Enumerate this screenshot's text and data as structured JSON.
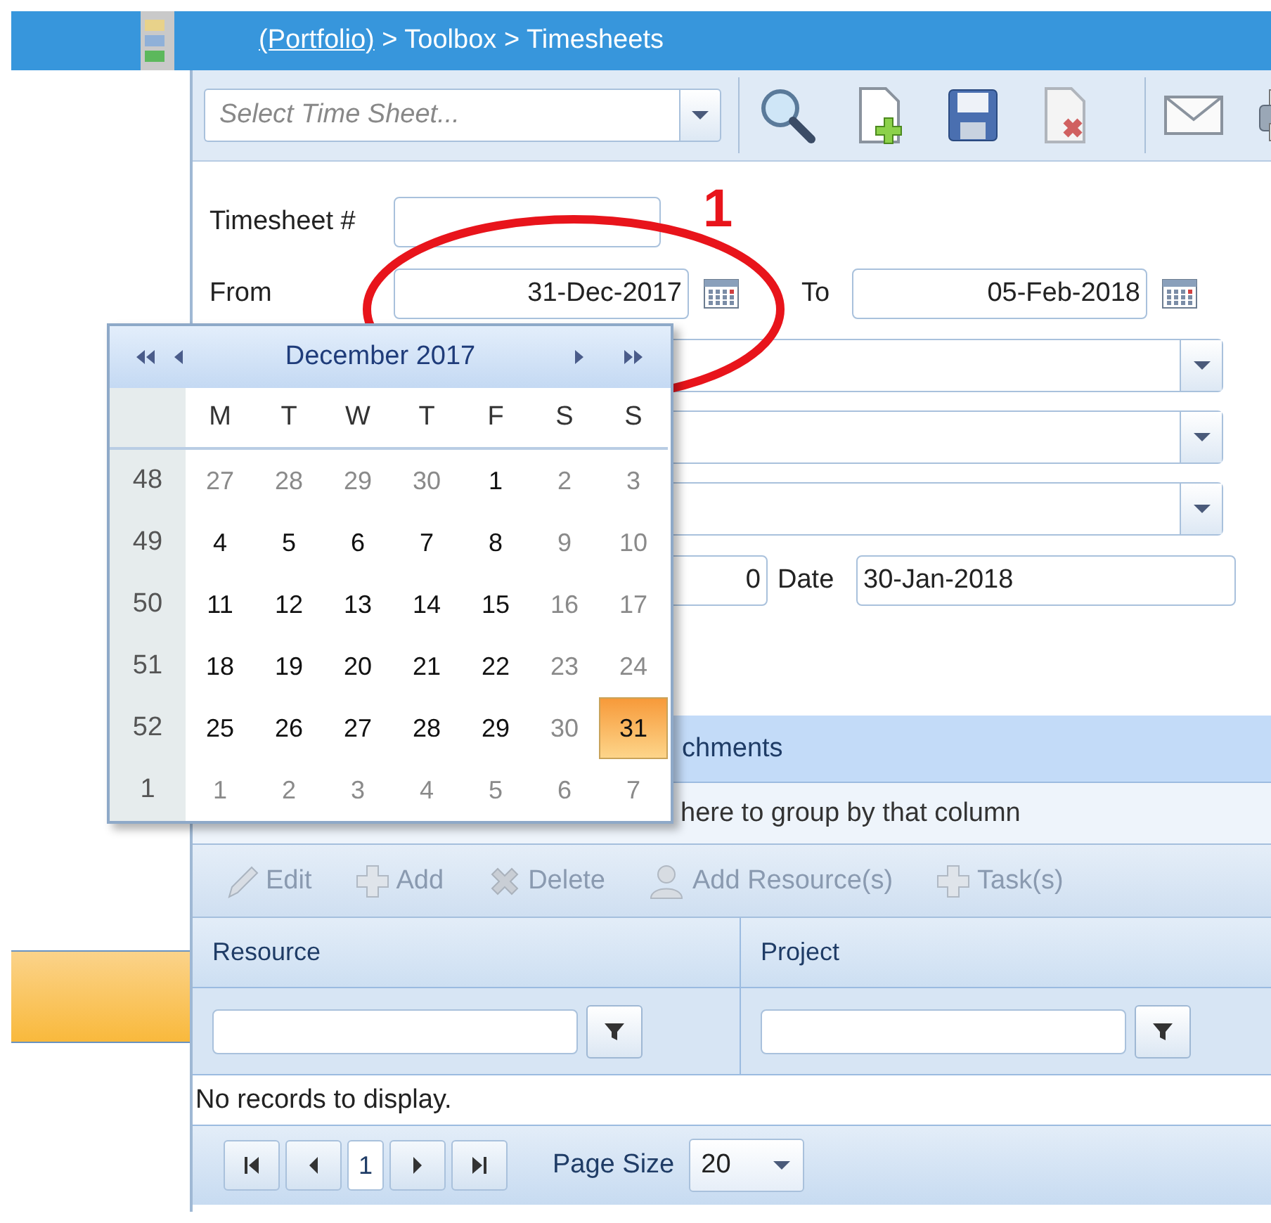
{
  "breadcrumb": {
    "link": "(Portfolio)",
    "path": "> Toolbox > Timesheets"
  },
  "toolbar": {
    "select_placeholder": "Select Time Sheet..."
  },
  "form": {
    "timesheet_label": "Timesheet #",
    "from_label": "From",
    "from_value": "31-Dec-2017",
    "to_label": "To",
    "to_value": "05-Feb-2018",
    "number_value": "0",
    "date_label": "Date",
    "date_value": "30-Jan-2018"
  },
  "annotation": {
    "label": "1"
  },
  "calendar": {
    "title": "December 2017",
    "weekdays": [
      "M",
      "T",
      "W",
      "T",
      "F",
      "S",
      "S"
    ],
    "weeks": [
      {
        "number": "48",
        "days": [
          {
            "day": "27",
            "muted": true,
            "selected": false
          },
          {
            "day": "28",
            "muted": true,
            "selected": false
          },
          {
            "day": "29",
            "muted": true,
            "selected": false
          },
          {
            "day": "30",
            "muted": true,
            "selected": false
          },
          {
            "day": "1",
            "muted": false,
            "selected": false
          },
          {
            "day": "2",
            "muted": true,
            "selected": false
          },
          {
            "day": "3",
            "muted": true,
            "selected": false
          }
        ]
      },
      {
        "number": "49",
        "days": [
          {
            "day": "4",
            "muted": false,
            "selected": false
          },
          {
            "day": "5",
            "muted": false,
            "selected": false
          },
          {
            "day": "6",
            "muted": false,
            "selected": false
          },
          {
            "day": "7",
            "muted": false,
            "selected": false
          },
          {
            "day": "8",
            "muted": false,
            "selected": false
          },
          {
            "day": "9",
            "muted": true,
            "selected": false
          },
          {
            "day": "10",
            "muted": true,
            "selected": false
          }
        ]
      },
      {
        "number": "50",
        "days": [
          {
            "day": "11",
            "muted": false,
            "selected": false
          },
          {
            "day": "12",
            "muted": false,
            "selected": false
          },
          {
            "day": "13",
            "muted": false,
            "selected": false
          },
          {
            "day": "14",
            "muted": false,
            "selected": false
          },
          {
            "day": "15",
            "muted": false,
            "selected": false
          },
          {
            "day": "16",
            "muted": true,
            "selected": false
          },
          {
            "day": "17",
            "muted": true,
            "selected": false
          }
        ]
      },
      {
        "number": "51",
        "days": [
          {
            "day": "18",
            "muted": false,
            "selected": false
          },
          {
            "day": "19",
            "muted": false,
            "selected": false
          },
          {
            "day": "20",
            "muted": false,
            "selected": false
          },
          {
            "day": "21",
            "muted": false,
            "selected": false
          },
          {
            "day": "22",
            "muted": false,
            "selected": false
          },
          {
            "day": "23",
            "muted": true,
            "selected": false
          },
          {
            "day": "24",
            "muted": true,
            "selected": false
          }
        ]
      },
      {
        "number": "52",
        "days": [
          {
            "day": "25",
            "muted": false,
            "selected": false
          },
          {
            "day": "26",
            "muted": false,
            "selected": false
          },
          {
            "day": "27",
            "muted": false,
            "selected": false
          },
          {
            "day": "28",
            "muted": false,
            "selected": false
          },
          {
            "day": "29",
            "muted": false,
            "selected": false
          },
          {
            "day": "30",
            "muted": true,
            "selected": false
          },
          {
            "day": "31",
            "muted": false,
            "selected": true
          }
        ]
      },
      {
        "number": "1",
        "days": [
          {
            "day": "1",
            "muted": true,
            "selected": false
          },
          {
            "day": "2",
            "muted": true,
            "selected": false
          },
          {
            "day": "3",
            "muted": true,
            "selected": false
          },
          {
            "day": "4",
            "muted": true,
            "selected": false
          },
          {
            "day": "5",
            "muted": true,
            "selected": false
          },
          {
            "day": "6",
            "muted": true,
            "selected": false
          },
          {
            "day": "7",
            "muted": true,
            "selected": false
          }
        ]
      }
    ]
  },
  "tab_text": "chments",
  "group_hint": "here to group by that column",
  "grid_toolbar": [
    {
      "kind": "edit",
      "label": "Edit",
      "disabled": true
    },
    {
      "kind": "add",
      "label": "Add",
      "disabled": true
    },
    {
      "kind": "delete",
      "label": "Delete",
      "disabled": true
    },
    {
      "kind": "resource",
      "label": "Add Resource(s)",
      "disabled": true
    },
    {
      "kind": "add",
      "label": "Task(s)",
      "disabled": true
    }
  ],
  "columns": [
    "Resource",
    "Project"
  ],
  "empty_message": "No records to display.",
  "pager": {
    "page": "1",
    "page_size_label": "Page Size",
    "page_size": "20"
  }
}
